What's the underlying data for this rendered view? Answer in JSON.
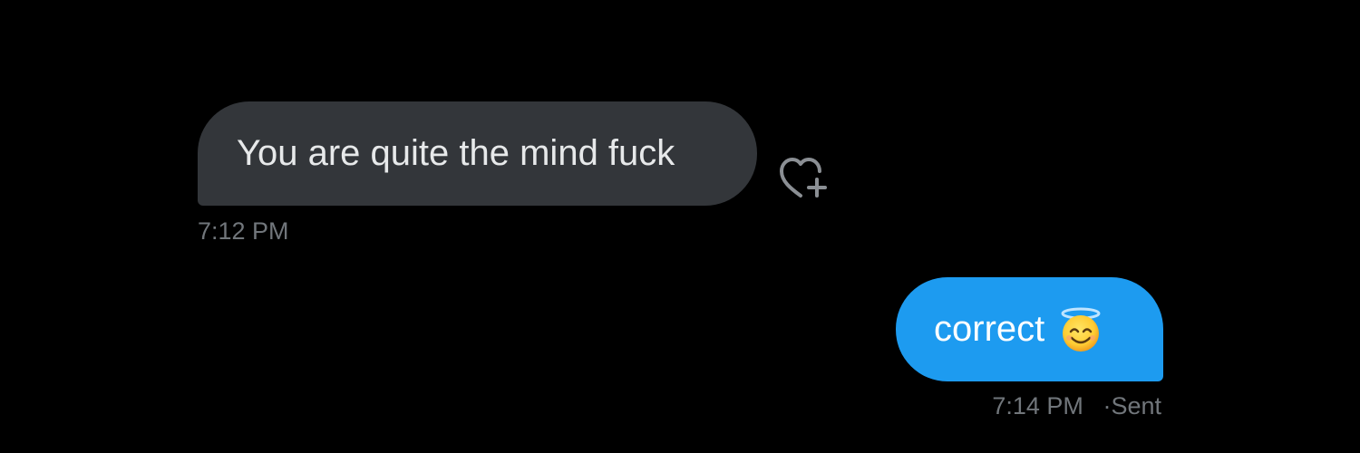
{
  "conversation": {
    "received": {
      "text": "You are quite the mind fuck",
      "time": "7:12 PM",
      "reaction_icon": "heart-plus-icon"
    },
    "sent": {
      "text": "correct",
      "emoji": "smiling-face-with-halo",
      "time": "7:14 PM",
      "status_separator": "·",
      "status": "Sent"
    }
  },
  "colors": {
    "background": "#000000",
    "received_bubble": "#33363a",
    "sent_bubble": "#1d9bf0",
    "meta_text": "#71767b"
  }
}
